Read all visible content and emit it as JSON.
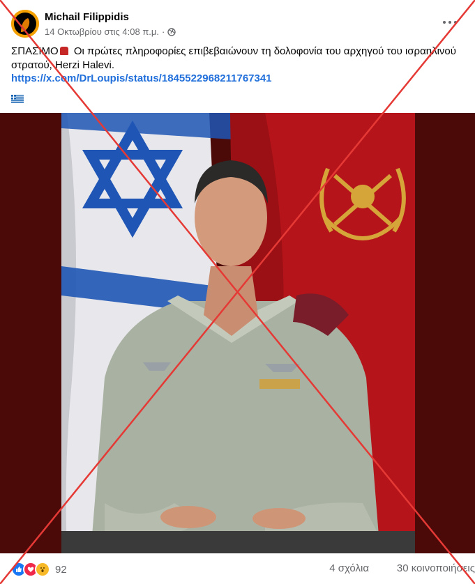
{
  "post": {
    "author": "Michail Filippidis",
    "timestamp": "14 Οκτωβρίου στις 4:08 π.μ.",
    "privacy_icon": "globe-icon",
    "text_prefix": "ΣΠΑΣΙΜΟ",
    "text_body": "Οι πρώτες πληροφορίες επιβεβαιώνουν τη δολοφονία του αρχηγού του ισραηλινού στρατού, Herzi Halevi.",
    "link": "https://x.com/DrLoupis/status/1845522968211767341",
    "flag_icon": "greek-flag-icon"
  },
  "footer": {
    "reaction_count": "92",
    "comments": "4 σχόλια",
    "shares": "30 κοινοποιήσεις"
  },
  "colors": {
    "link": "#216fdb",
    "meta": "#65676b",
    "cross": "#e53935",
    "photo_bg": "#4b0a08"
  }
}
